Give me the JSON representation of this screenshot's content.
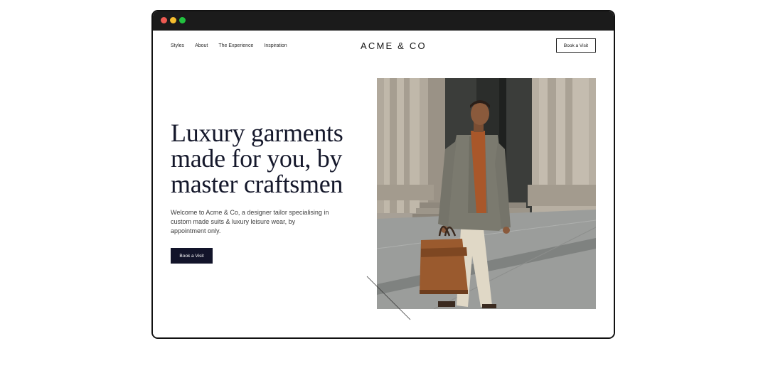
{
  "nav": {
    "items": [
      "Styles",
      "About",
      "The Experience",
      "Inspiration"
    ]
  },
  "brand": {
    "logo": "ACME & CO"
  },
  "header": {
    "book_label": "Book a Visit"
  },
  "hero": {
    "headline": "Luxury garments made for you, by master craftsmen",
    "intro": "Welcome to Acme & Co, a designer tailor specialising in custom made suits & luxury leisure wear, by appointment only.",
    "cta_label": "Book a Visit"
  },
  "colors": {
    "window_chrome": "#1b1b1b",
    "close_dot": "#ee5a52",
    "minimize_dot": "#f5bd2e",
    "zoom_dot": "#22c23f",
    "headline": "#15182b",
    "cta_background": "#12142a"
  },
  "icons": [
    "window-close-icon",
    "window-minimize-icon",
    "window-zoom-icon"
  ]
}
